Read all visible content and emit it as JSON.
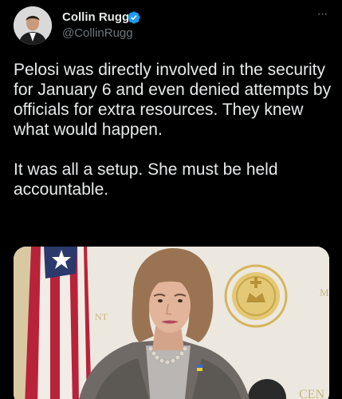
{
  "author": {
    "display_name": "Collin Rugg",
    "handle": "@CollinRugg",
    "verified": true,
    "avatar_icon": "profile-photo"
  },
  "more_icon": "more-options-icon",
  "tweet": {
    "paragraphs": [
      "Pelosi was directly involved in the security for January 6 and even denied attempts by officials for extra resources. They knew what would happen.",
      "It was all a setup. She must be held accountable."
    ]
  },
  "media": {
    "description_icon": "news-photo",
    "seal_letter": "M",
    "backdrop_letters": "CEN",
    "backdrop_side_letters": "NT"
  },
  "colors": {
    "background": "#000000",
    "text_primary": "#e7e9ea",
    "text_secondary": "#71767b",
    "verified_blue": "#1d9bf0"
  }
}
